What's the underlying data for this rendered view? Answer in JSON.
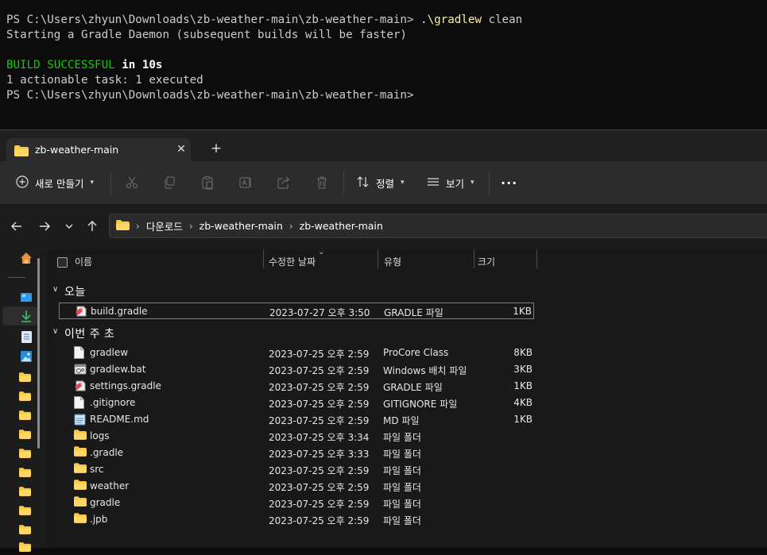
{
  "terminal": {
    "line1_prompt": "PS C:\\Users\\zhyun\\Downloads\\zb-weather-main\\zb-weather-main> ",
    "line1_cmd": ".\\gradlew",
    "line1_arg": " clean",
    "line2": "Starting a Gradle Daemon (subsequent builds will be faster)",
    "line4_status": "BUILD SUCCESSFUL",
    "line4_rest": " in 10s",
    "line5": "1 actionable task: 1 executed",
    "line6": "PS C:\\Users\\zhyun\\Downloads\\zb-weather-main\\zb-weather-main>"
  },
  "tab": {
    "title": "zb-weather-main",
    "close": "✕",
    "new_tab": "+"
  },
  "toolbar": {
    "new_label": "새로 만들기",
    "sort_label": "정렬",
    "view_label": "보기",
    "more": "···"
  },
  "address": {
    "crumbs": [
      "다운로드",
      "zb-weather-main",
      "zb-weather-main"
    ],
    "sep": "›"
  },
  "columns": {
    "name": "이름",
    "date": "수정한 날짜",
    "type": "유형",
    "size": "크기"
  },
  "groups": {
    "today": "오늘",
    "this_week": "이번 주 초"
  },
  "files_today": [
    {
      "name": "build.gradle",
      "date": "2023-07-27 오후 3:50",
      "type": "GRADLE 파일",
      "size": "1KB",
      "icon": "gradle-file-icon"
    }
  ],
  "files_week": [
    {
      "name": "gradlew",
      "date": "2023-07-25 오후 2:59",
      "type": "ProCore Class",
      "size": "8KB",
      "icon": "blank-file-icon"
    },
    {
      "name": "gradlew.bat",
      "date": "2023-07-25 오후 2:59",
      "type": "Windows 배치 파일",
      "size": "3KB",
      "icon": "batch-file-icon"
    },
    {
      "name": "settings.gradle",
      "date": "2023-07-25 오후 2:59",
      "type": "GRADLE 파일",
      "size": "1KB",
      "icon": "gradle-file-icon"
    },
    {
      "name": ".gitignore",
      "date": "2023-07-25 오후 2:59",
      "type": "GITIGNORE 파일",
      "size": "4KB",
      "icon": "blank-file-icon"
    },
    {
      "name": "README.md",
      "date": "2023-07-25 오후 2:59",
      "type": "MD 파일",
      "size": "1KB",
      "icon": "notepad-file-icon"
    },
    {
      "name": "logs",
      "date": "2023-07-25 오후 3:34",
      "type": "파일 폴더",
      "size": "",
      "icon": "folder-icon"
    },
    {
      "name": ".gradle",
      "date": "2023-07-25 오후 3:33",
      "type": "파일 폴더",
      "size": "",
      "icon": "folder-icon"
    },
    {
      "name": "src",
      "date": "2023-07-25 오후 2:59",
      "type": "파일 폴더",
      "size": "",
      "icon": "folder-icon"
    },
    {
      "name": "weather",
      "date": "2023-07-25 오후 2:59",
      "type": "파일 폴더",
      "size": "",
      "icon": "folder-icon"
    },
    {
      "name": "gradle",
      "date": "2023-07-25 오후 2:59",
      "type": "파일 폴더",
      "size": "",
      "icon": "folder-icon"
    },
    {
      "name": ".jpb",
      "date": "2023-07-25 오후 2:59",
      "type": "파일 폴더",
      "size": "",
      "icon": "folder-icon"
    }
  ],
  "colors": {
    "folder": "#f8c943",
    "accent": "#4cc2ff",
    "terminal_cmd": "#f9f1a5",
    "build_ok": "#16c60c"
  }
}
